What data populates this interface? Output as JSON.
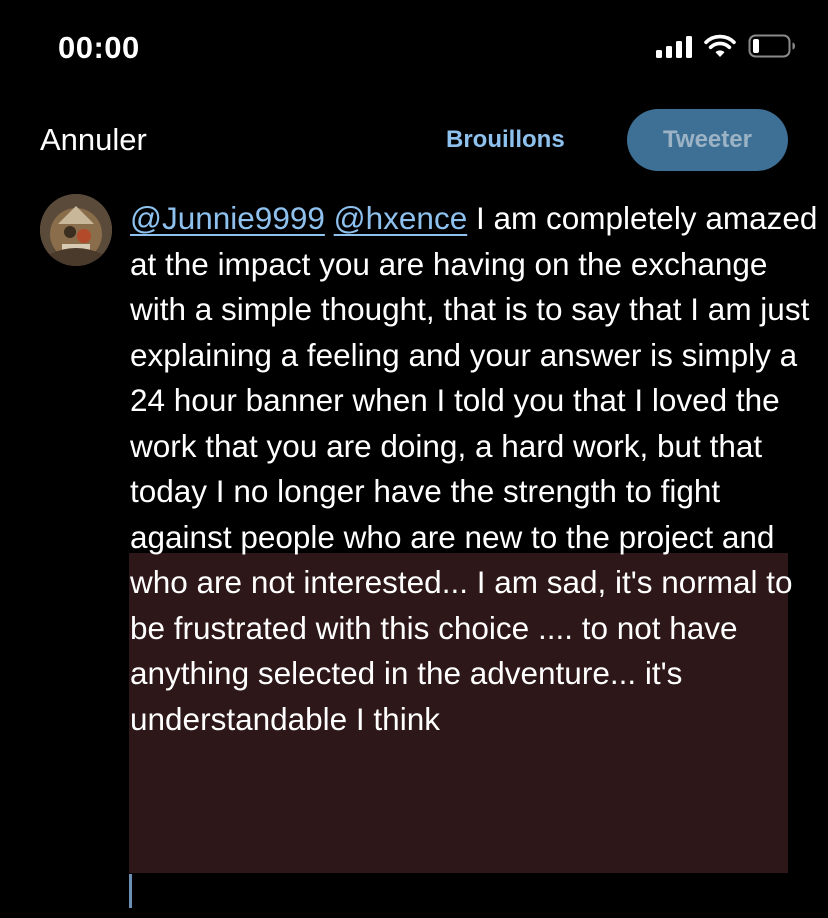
{
  "status_bar": {
    "time": "00:00"
  },
  "compose": {
    "cancel_label": "Annuler",
    "drafts_label": "Brouillons",
    "tweet_label": "Tweeter"
  },
  "tweet": {
    "mention_1": "@Junnie9999",
    "mention_2": "@hxence",
    "body": "I am completely amazed at the impact you are having on the exchange with a simple thought, that is to say that I am just explaining a feeling and your answer is simply a 24 hour banner when I told you that I loved the work that you are doing, a hard work, but that today I no longer have the strength to fight against people who are new to the project and who are not interested... I am sad, it's normal to be frustrated with this choice .... to not have anything selected in the adventure... it's understandable I think"
  },
  "colors": {
    "background": "#000000",
    "link": "#8ec1ee",
    "tweet_button_bg": "#3e6f94",
    "selection": "#2d1718"
  },
  "icons": [
    "signal-icon",
    "wifi-icon",
    "battery-icon"
  ]
}
